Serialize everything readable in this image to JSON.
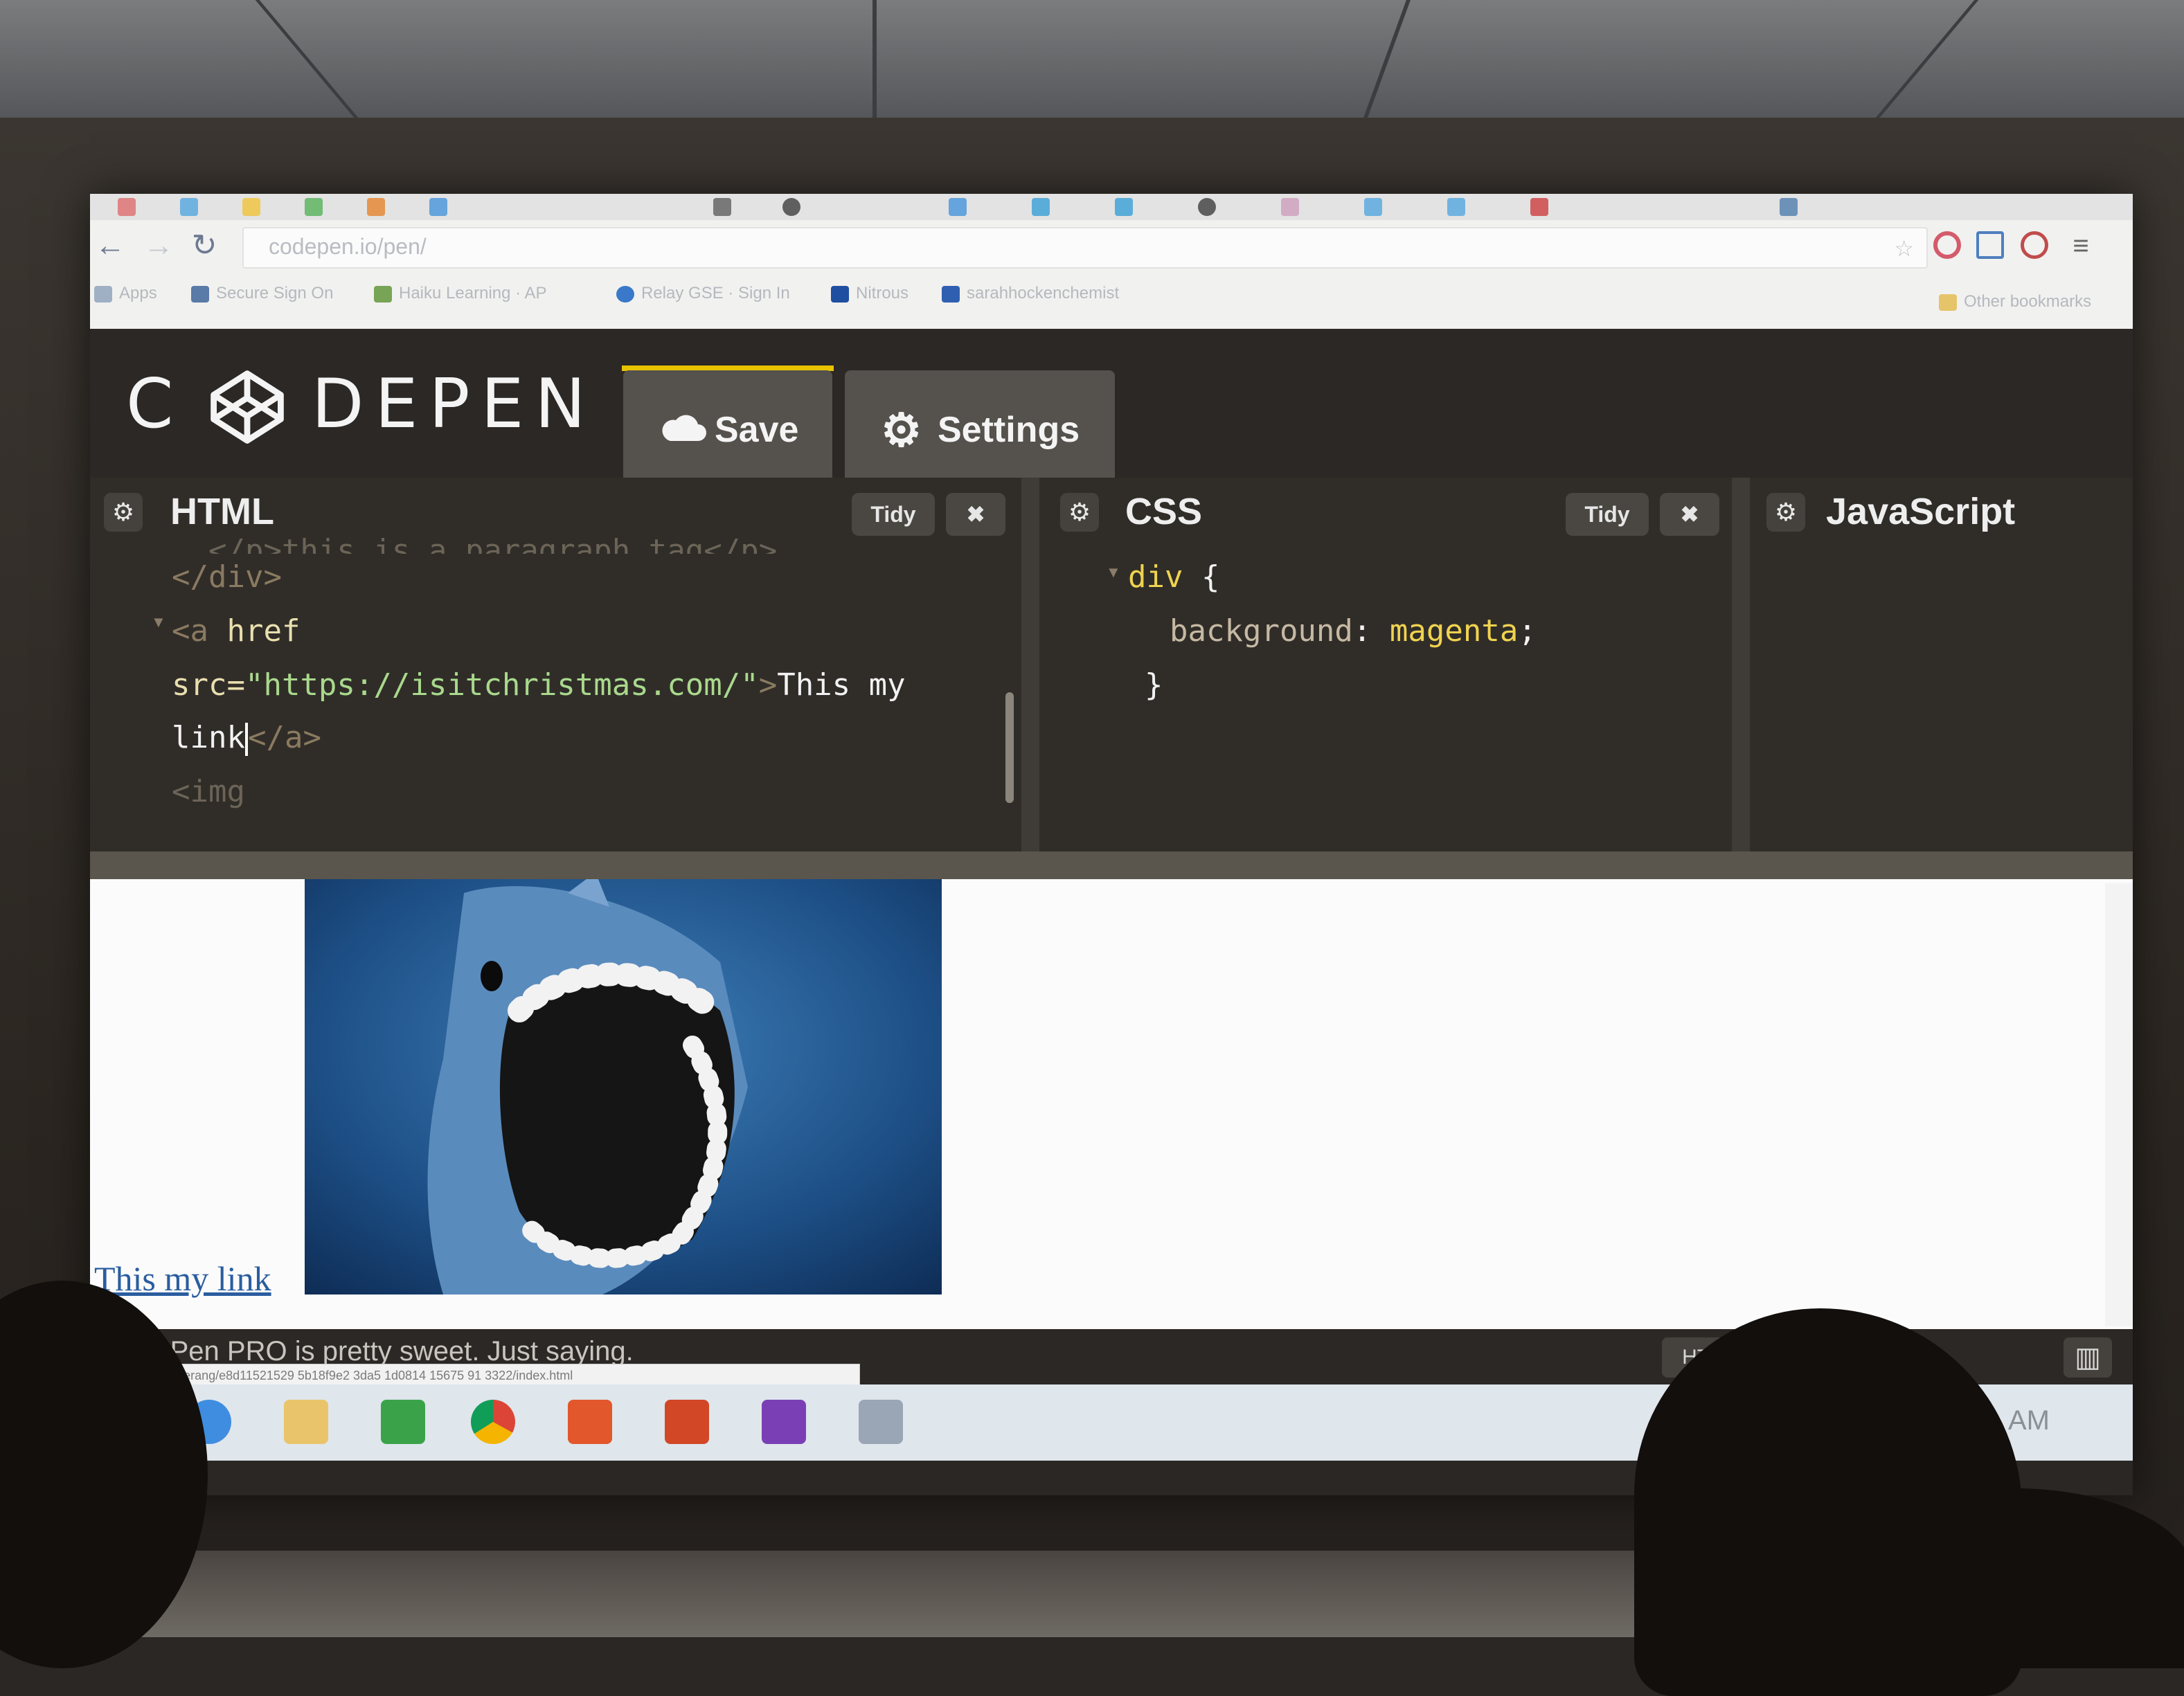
{
  "browser": {
    "url": "codepen.io/pen/",
    "bookmarks": [
      {
        "label": "Apps",
        "icon": "apps-grid-icon"
      },
      {
        "label": "Secure Sign On",
        "icon": "cloud-link-icon"
      },
      {
        "label": "Haiku Learning · AP",
        "icon": "haiku-leaf-icon"
      },
      {
        "label": "Relay GSE · Sign In",
        "icon": "relay-icon"
      },
      {
        "label": "Nitrous",
        "icon": "nitrous-icon"
      },
      {
        "label": "sarahhockenchemist",
        "icon": "v-logo-icon"
      }
    ],
    "other_bookmarks": "Other bookmarks"
  },
  "codepen": {
    "logo_text_c": "C",
    "logo_text_rest": "DEPEN",
    "save_label": "Save",
    "settings_label": "Settings"
  },
  "editors": {
    "html": {
      "title": "HTML",
      "tidy_label": "Tidy",
      "close_label": "✖",
      "lines": {
        "l1_partial": "  </p>this is a paragraph tag</p>",
        "l2": "</div>",
        "l3_tag": "<a",
        "l3_attr": " href",
        "l4_attr": "src=",
        "l4_str": "\"https://isitchristmas.com/\"",
        "l4_gt": ">",
        "l4_txt": "This my",
        "l5_txt": "link",
        "l5_close": "</a>",
        "l6": "<img"
      }
    },
    "css": {
      "title": "CSS",
      "tidy_label": "Tidy",
      "close_label": "✖",
      "selector": "div",
      "open_brace": " {",
      "property": "background",
      "colon": ": ",
      "value": "magenta",
      "semicolon": ";",
      "close_brace": "}"
    },
    "js": {
      "title": "JavaScript"
    }
  },
  "preview": {
    "link_text": "This my link",
    "image_icon": "shark-image"
  },
  "footer": {
    "message": "CodePen PRO is pretty sweet. Just saying.",
    "status_url": "s.cdpn.io/boomerang/e8d11521529 5b18f9e2 3da5 1d0814 15675 91 3322/index.html",
    "html_button": "HTML"
  },
  "taskbar": {
    "clock": "AM",
    "apps": [
      "internet-explorer-icon",
      "file-explorer-icon",
      "store-icon",
      "chrome-icon",
      "media-player-icon",
      "office-icon",
      "onenote-icon",
      "excel-icon"
    ]
  },
  "colors": {
    "codepen_bg": "#2b2825",
    "save_accent": "#e8c400",
    "css_value": "#f0d34f",
    "string": "#a9d98c",
    "link": "#2a5d9f"
  }
}
